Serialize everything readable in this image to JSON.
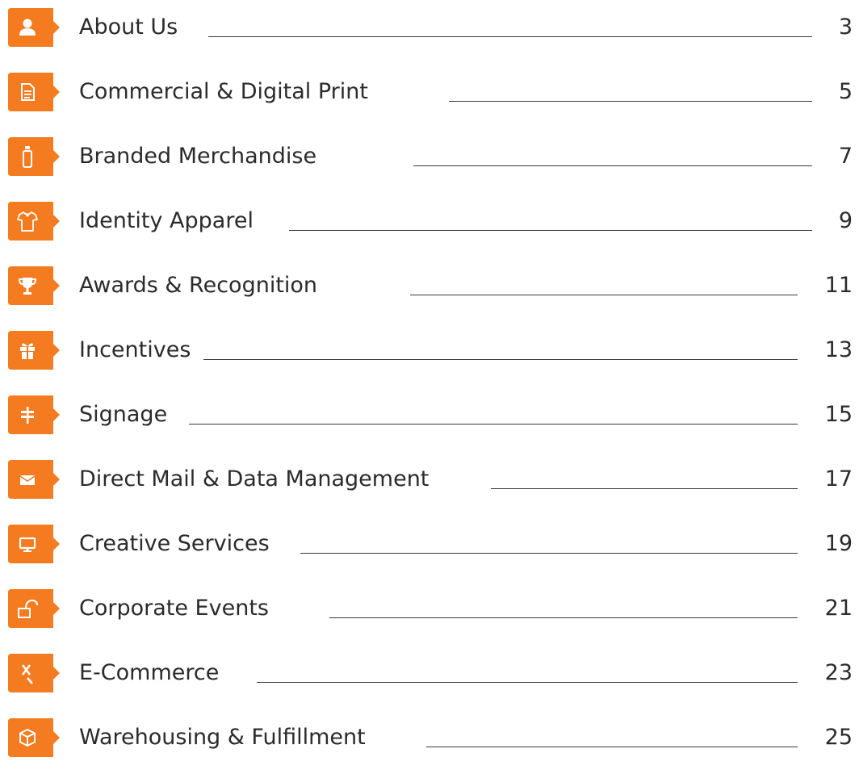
{
  "accent_color": "#F47B20",
  "toc": [
    {
      "title": "About Us",
      "page": "3",
      "icon": "user-icon"
    },
    {
      "title": "Commercial & Digital Print",
      "page": "5",
      "icon": "document-icon"
    },
    {
      "title": "Branded Merchandise",
      "page": "7",
      "icon": "water-bottle-icon"
    },
    {
      "title": "Identity Apparel",
      "page": "9",
      "icon": "shirt-icon"
    },
    {
      "title": "Awards & Recognition",
      "page": "11",
      "icon": "trophy-icon"
    },
    {
      "title": "Incentives",
      "page": "13",
      "icon": "gift-icon"
    },
    {
      "title": "Signage",
      "page": "15",
      "icon": "signpost-icon"
    },
    {
      "title": "Direct Mail & Data Management",
      "page": "17",
      "icon": "envelope-icon"
    },
    {
      "title": "Creative Services",
      "page": "19",
      "icon": "monitor-icon"
    },
    {
      "title": "Corporate Events",
      "page": "21",
      "icon": "event-banner-icon"
    },
    {
      "title": "E-Commerce",
      "page": "23",
      "icon": "cursor-click-icon"
    },
    {
      "title": "Warehousing & Fulfillment",
      "page": "25",
      "icon": "package-icon"
    }
  ]
}
